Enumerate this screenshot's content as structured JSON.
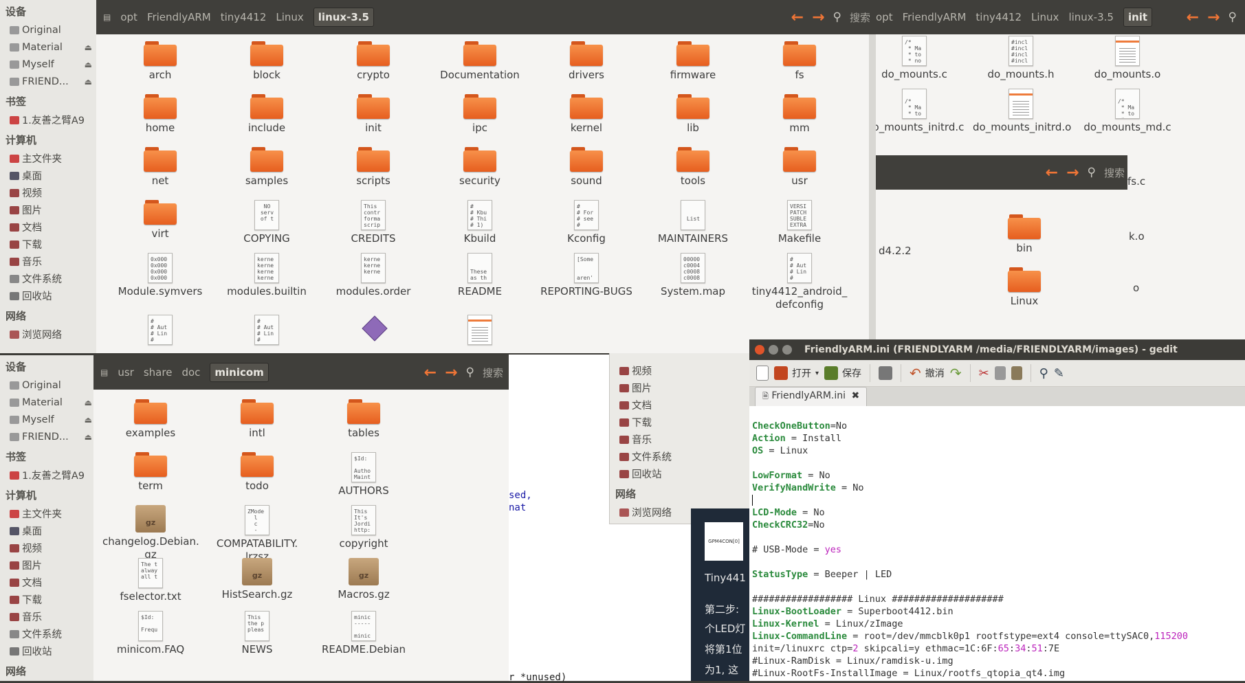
{
  "nautilus_top": {
    "breadcrumbs": [
      "opt",
      "FriendlyARM",
      "tiny4412",
      "Linux",
      "linux-3.5"
    ],
    "search_label": "搜索",
    "items": [
      {
        "type": "folder",
        "name": "arch"
      },
      {
        "type": "folder",
        "name": "block"
      },
      {
        "type": "folder",
        "name": "crypto"
      },
      {
        "type": "folder",
        "name": "Documentation"
      },
      {
        "type": "folder",
        "name": "drivers"
      },
      {
        "type": "folder",
        "name": "firmware"
      },
      {
        "type": "folder",
        "name": "fs"
      },
      {
        "type": "folder",
        "name": "home"
      },
      {
        "type": "folder",
        "name": "include"
      },
      {
        "type": "folder",
        "name": "init"
      },
      {
        "type": "folder",
        "name": "ipc"
      },
      {
        "type": "folder",
        "name": "kernel"
      },
      {
        "type": "folder",
        "name": "lib"
      },
      {
        "type": "folder",
        "name": "mm"
      },
      {
        "type": "folder",
        "name": "net"
      },
      {
        "type": "folder",
        "name": "samples"
      },
      {
        "type": "folder",
        "name": "scripts"
      },
      {
        "type": "folder",
        "name": "security"
      },
      {
        "type": "folder",
        "name": "sound"
      },
      {
        "type": "folder",
        "name": "tools"
      },
      {
        "type": "folder",
        "name": "usr"
      },
      {
        "type": "folder",
        "name": "virt"
      },
      {
        "type": "file",
        "name": "COPYING",
        "preview": "  NO\n serv\n of t"
      },
      {
        "type": "file",
        "name": "CREDITS",
        "preview": "This\ncontr\nforma\nscrip"
      },
      {
        "type": "file",
        "name": "Kbuild",
        "preview": "#\n# Kbu\n# Thi\n# 1)"
      },
      {
        "type": "file",
        "name": "Kconfig",
        "preview": "#\n# For\n# see\n#"
      },
      {
        "type": "file",
        "name": "MAINTAINERS",
        "preview": "\n\n List"
      },
      {
        "type": "file",
        "name": "Makefile",
        "preview": "VERSI\nPATCH\nSUBLE\nEXTRA"
      },
      {
        "type": "file",
        "name": "Module.symvers",
        "preview": "0x000\n0x000\n0x000\n0x000"
      },
      {
        "type": "file",
        "name": "modules.builtin",
        "preview": "kerne\nkerne\nkerne\nkerne"
      },
      {
        "type": "file",
        "name": "modules.order",
        "preview": "kerne\nkerne\nkerne"
      },
      {
        "type": "file",
        "name": "README",
        "preview": "\n\nThese\nas th"
      },
      {
        "type": "file",
        "name": "REPORTING-BUGS",
        "preview": "[Some\n\n\naren'"
      },
      {
        "type": "file",
        "name": "System.map",
        "preview": "00000\nc0004\nc0008\nc0008"
      },
      {
        "type": "file",
        "name": "tiny4412_android_\ndefconfig",
        "preview": "#\n# Aut\n# Lin\n#"
      }
    ]
  },
  "nautilus_right": {
    "breadcrumbs": [
      "opt",
      "FriendlyARM",
      "tiny4412",
      "Linux",
      "linux-3.5",
      "init"
    ],
    "search_label": "搜索",
    "items": [
      {
        "type": "file",
        "name": "do_mounts.c",
        "preview": "/*\n * Ma\n * to\n * no"
      },
      {
        "type": "file",
        "name": "do_mounts.h",
        "preview": "#incl\n#incl\n#incl\n#incl"
      },
      {
        "type": "doc",
        "name": "do_mounts.o"
      },
      {
        "type": "file",
        "name": "do_mounts_initrd.c",
        "preview": "\n/*\n * Ma\n * to"
      },
      {
        "type": "doc",
        "name": "do_mounts_initrd.o"
      },
      {
        "type": "file",
        "name": "do_mounts_md.c",
        "preview": "\n/*\n * Ma\n * to\n * no"
      }
    ],
    "partial_labels": [
      "fs.c",
      "k.o",
      "o"
    ]
  },
  "nautilus_mid": {
    "search_label": "搜索",
    "items": [
      {
        "type": "folder",
        "name": "bin"
      },
      {
        "type": "folder",
        "name": "Linux"
      }
    ],
    "partial_label": "d4.2.2"
  },
  "sidebar": {
    "devices_header": "设备",
    "devices": [
      "Original",
      "Material",
      "Myself",
      "FRIEND..."
    ],
    "bookmarks_header": "书签",
    "bookmarks": [
      "1.友善之臂A9"
    ],
    "computer_header": "计算机",
    "computer": [
      "主文件夹",
      "桌面",
      "视频",
      "图片",
      "文档",
      "下载",
      "音乐",
      "文件系统",
      "回收站"
    ],
    "network_header": "网络",
    "network": [
      "浏览网络"
    ]
  },
  "nautilus_bottom": {
    "breadcrumbs": [
      "usr",
      "share",
      "doc",
      "minicom"
    ],
    "search_label": "搜索",
    "items": [
      {
        "type": "folder",
        "name": "examples"
      },
      {
        "type": "folder",
        "name": "intl"
      },
      {
        "type": "folder",
        "name": "tables"
      },
      {
        "type": "folder",
        "name": "term"
      },
      {
        "type": "folder",
        "name": "todo"
      },
      {
        "type": "file",
        "name": "AUTHORS",
        "preview": "$Id:\n\nAutho\nMaint"
      },
      {
        "type": "gz",
        "name": "changelog.Debian.\ngz"
      },
      {
        "type": "file",
        "name": "COMPATABILITY.\nlrzsz",
        "preview": "ZMode\n  l\n  c\n  -"
      },
      {
        "type": "file",
        "name": "copyright",
        "preview": "This\nIt's\nJordi\nhttp:"
      },
      {
        "type": "file",
        "name": "fselector.txt",
        "preview": "The t\nalway\nall t"
      },
      {
        "type": "gz",
        "name": "HistSearch.gz"
      },
      {
        "type": "gz",
        "name": "Macros.gz"
      },
      {
        "type": "file",
        "name": "minicom.FAQ",
        "preview": "$Id:\n\nFrequ"
      },
      {
        "type": "file",
        "name": "NEWS",
        "preview": "This\nthe p\npleas"
      },
      {
        "type": "file",
        "name": "README.Debian",
        "preview": "minic\n-----\n\nminic"
      }
    ]
  },
  "background_sidebar": {
    "items": [
      "视频",
      "图片",
      "文档",
      "下载",
      "音乐",
      "文件系统",
      "回收站"
    ],
    "network_header": "网络",
    "network": [
      "浏览网络"
    ]
  },
  "background_fragments": {
    "code": [
      "sed,",
      "nat"
    ],
    "unused": "r *unused)",
    "doc_lines": [
      "Tiny441",
      "第二步:",
      "个LED灯",
      "将第1位",
      "为1, 这"
    ],
    "image_label": "GPM4CON[0]"
  },
  "gedit": {
    "title": "FriendlyARM.ini (FRIENDLYARM /media/FRIENDLYARM/images) - gedit",
    "toolbar": {
      "open": "打开",
      "save": "保存",
      "undo": "撤消"
    },
    "tab": "FriendlyARM.ini",
    "lines": [
      [
        [
          "k",
          "CheckOneButton"
        ],
        [
          "c",
          "=No"
        ]
      ],
      [
        [
          "k",
          "Action"
        ],
        [
          "c",
          " = Install"
        ]
      ],
      [
        [
          "k",
          "OS"
        ],
        [
          "c",
          " = Linux"
        ]
      ],
      [],
      [
        [
          "k",
          "LowFormat"
        ],
        [
          "c",
          " = No"
        ]
      ],
      [
        [
          "k",
          "VerifyNandWrite"
        ],
        [
          "c",
          " = No"
        ]
      ],
      [
        [
          "cur",
          ""
        ]
      ],
      [
        [
          "k",
          "LCD-Mode"
        ],
        [
          "c",
          " = No"
        ]
      ],
      [
        [
          "k",
          "CheckCRC32"
        ],
        [
          "c",
          "=No"
        ]
      ],
      [],
      [
        [
          "c",
          "# USB-Mode = "
        ],
        [
          "v",
          "yes"
        ]
      ],
      [],
      [
        [
          "k",
          "StatusType"
        ],
        [
          "c",
          " = Beeper | LED"
        ]
      ],
      [],
      [
        [
          "c",
          "################## Linux ####################"
        ]
      ],
      [
        [
          "k",
          "Linux-BootLoader"
        ],
        [
          "c",
          " = Superboot4412.bin"
        ]
      ],
      [
        [
          "k",
          "Linux-Kernel"
        ],
        [
          "c",
          " = Linux/zImage"
        ]
      ],
      [
        [
          "k",
          "Linux-CommandLine"
        ],
        [
          "c",
          " = root=/dev/mmcblk0p1 rootfstype=ext4 console=ttySAC0,"
        ],
        [
          "v",
          "115200"
        ]
      ],
      [
        [
          "c",
          "init=/linuxrc ctp="
        ],
        [
          "v",
          "2"
        ],
        [
          "c",
          " skipcali=y ethmac=1C:6F:"
        ],
        [
          "v",
          "65"
        ],
        [
          "c",
          ":"
        ],
        [
          "v",
          "34"
        ],
        [
          "c",
          ":"
        ],
        [
          "v",
          "51"
        ],
        [
          "c",
          ":7E"
        ]
      ],
      [
        [
          "c",
          "#Linux-RamDisk = Linux/ramdisk-u.img"
        ]
      ],
      [
        [
          "c",
          "#Linux-RootFs-InstallImage = Linux/rootfs_qtopia_qt4.img"
        ]
      ]
    ]
  }
}
